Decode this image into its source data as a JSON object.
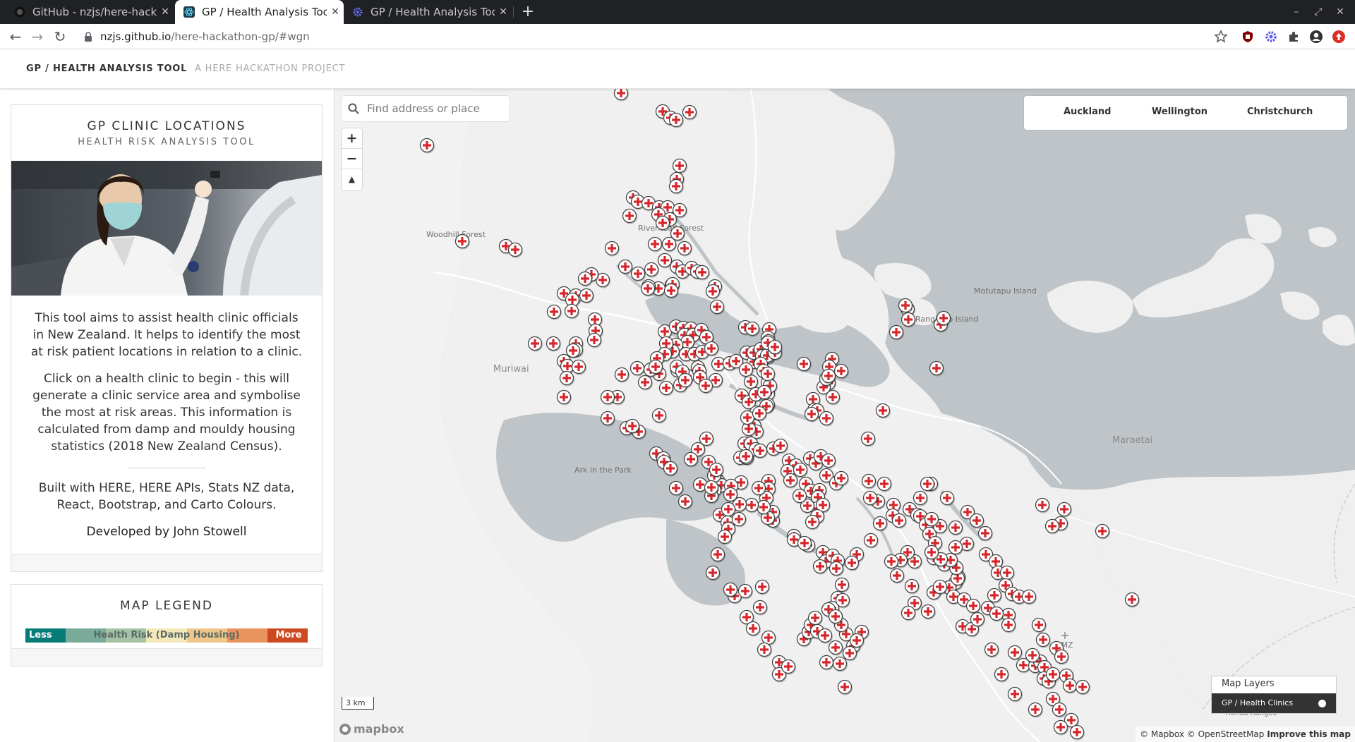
{
  "browser": {
    "tabs": [
      {
        "title": "GitHub - nzjs/here-hackat",
        "active": false,
        "icon": "github-icon"
      },
      {
        "title": "GP / Health Analysis Tool",
        "active": true,
        "icon": "react-icon"
      },
      {
        "title": "GP / Health Analysis Tool",
        "active": false,
        "icon": "gear-icon"
      }
    ],
    "url_host": "nzjs.github.io",
    "url_path": "/here-hackathon-gp/#wgn"
  },
  "app": {
    "brand": "GP / HEALTH ANALYSIS TOOL",
    "subbrand": "A HERE HACKATHON PROJECT"
  },
  "sidebar": {
    "title": "GP CLINIC LOCATIONS",
    "subtitle": "HEALTH RISK ANALYSIS TOOL",
    "paragraph1": "This tool aims to assist health clinic officials in New Zealand. It helps to identify the most at risk patient locations in relation to a clinic.",
    "paragraph2": "Click on a health clinic to begin - this will generate a clinic service area and symbolise the most at risk areas. This information is calculated from damp and mouldy housing statistics (2018 New Zealand Census).",
    "built_with": "Built with HERE, HERE APIs, Stats NZ data, React, Bootstrap, and Carto Colours.",
    "developer": "Developed by John Stowell"
  },
  "legend": {
    "title": "MAP LEGEND",
    "less": "Less",
    "more": "More",
    "caption": "Health Risk (Damp Housing)",
    "colors": [
      "#077b78",
      "#79aa9a",
      "#a4c3a6",
      "#f5e8b8",
      "#f0c589",
      "#e9935f",
      "#cd4a20"
    ]
  },
  "map": {
    "search_placeholder": "Find address or place",
    "cities": [
      "Auckland",
      "Wellington",
      "Christchurch"
    ],
    "scale": "3 km",
    "mapbox_logo": "mapbox",
    "attribution": "© Mapbox © OpenStreetMap",
    "improve": "Improve this map",
    "layers_title": "Map Layers",
    "layer_name": "GP / Health Clinics",
    "labels": {
      "woodhill": "Woodhill Forest",
      "riverhead": "Riverhead Forest",
      "muriwai": "Muriwai",
      "ark": "Ark in the Park",
      "rangitoto": "Rangitoto Island",
      "motutapu": "Motutapu Island",
      "maraetai": "Maraetai",
      "amz": "AMZ",
      "hunua": "Hunua Ranges"
    },
    "marker_color": "#d6262b"
  }
}
